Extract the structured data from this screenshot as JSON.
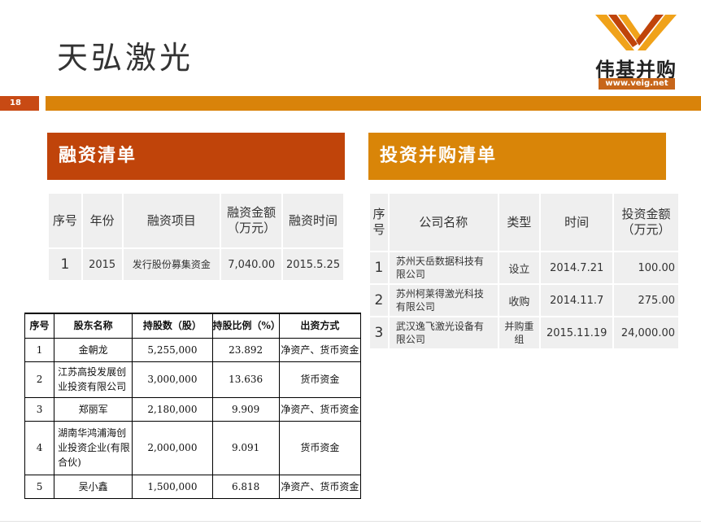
{
  "title": "天弘激光",
  "logo": {
    "brand": "伟基并购",
    "url": "www.veig.net",
    "colors": [
      "#f0a21a",
      "#c0440a"
    ]
  },
  "page_number": "18",
  "financing": {
    "heading": "融资清单",
    "headers": [
      "序号",
      "年份",
      "融资项目",
      "融资金额（万元）",
      "融资时间"
    ],
    "rows": [
      {
        "no": "1",
        "year": "2015",
        "project": "发行股份募集资金",
        "amount": "7,040.00",
        "date": "2015.5.25"
      }
    ]
  },
  "investment": {
    "heading": "投资并购清单",
    "headers": [
      "序号",
      "公司名称",
      "类型",
      "时间",
      "投资金额（万元）"
    ],
    "rows": [
      {
        "no": "1",
        "company": "苏州天岳数据科技有限公司",
        "type": "设立",
        "date": "2014.7.21",
        "amount": "100.00"
      },
      {
        "no": "2",
        "company": "苏州柯莱得激光科技有限公司",
        "type": "收购",
        "date": "2014.11.7",
        "amount": "275.00"
      },
      {
        "no": "3",
        "company": "武汉逸飞激光设备有限公司",
        "type": "并购重组",
        "date": "2015.11.19",
        "amount": "24,000.00"
      }
    ]
  },
  "shareholders": {
    "headers": [
      "序号",
      "股东名称",
      "持股数（股）",
      "持股比例（%）",
      "出资方式"
    ],
    "rows": [
      {
        "no": "1",
        "name": "金朝龙",
        "shares": "5,255,000",
        "ratio": "23.892",
        "method": "净资产、货币资金"
      },
      {
        "no": "2",
        "name": "江苏高投发展创业投资有限公司",
        "shares": "3,000,000",
        "ratio": "13.636",
        "method": "货币资金"
      },
      {
        "no": "3",
        "name": "郑丽军",
        "shares": "2,180,000",
        "ratio": "9.909",
        "method": "净资产、货币资金"
      },
      {
        "no": "4",
        "name": "湖南华鸿浦海创业投资企业(有限合伙)",
        "shares": "2,000,000",
        "ratio": "9.091",
        "method": "货币资金"
      },
      {
        "no": "5",
        "name": "吴小鑫",
        "shares": "1,500,000",
        "ratio": "6.818",
        "method": "净资产、货币资金"
      }
    ]
  }
}
